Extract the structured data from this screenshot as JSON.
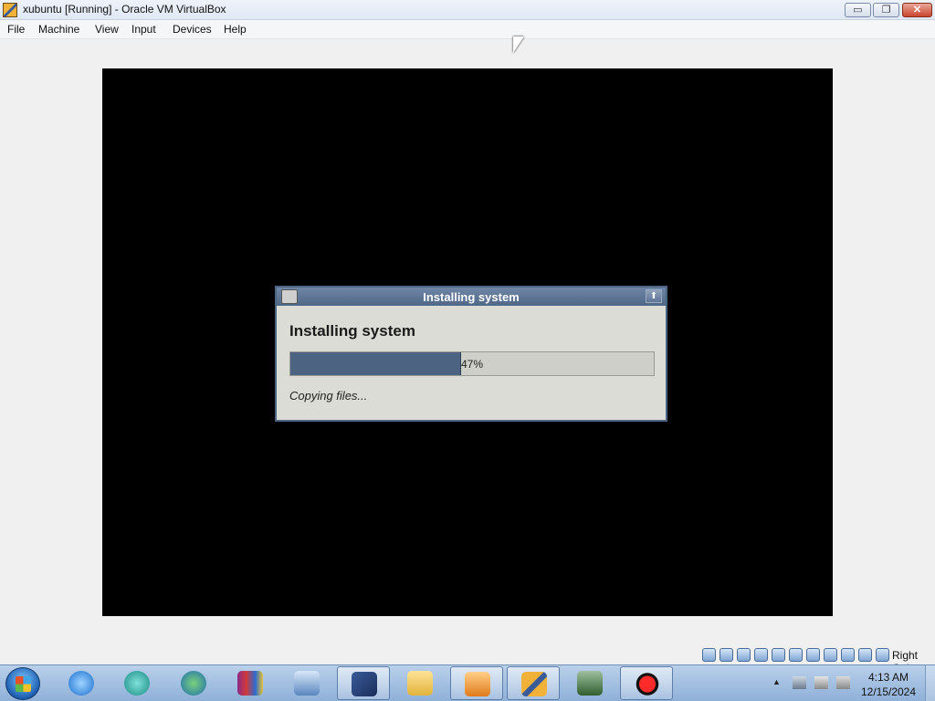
{
  "window": {
    "title": "xubuntu [Running] - Oracle VM VirtualBox",
    "minimize_symbol": "▭",
    "maximize_symbol": "❐",
    "close_symbol": "✕"
  },
  "menu": {
    "items": [
      "File",
      "Machine",
      "View",
      "Input",
      "Devices",
      "Help"
    ]
  },
  "installer": {
    "title": "Installing system",
    "heading": "Installing system",
    "progress_percent": 47,
    "progress_text": "47%",
    "status": "Copying files...",
    "title_button_symbol": "⬆"
  },
  "vbox_status": {
    "host_key_label": "Right Ctrl"
  },
  "taskbar": {
    "clock_time": "4:13 AM",
    "clock_date": "12/15/2024",
    "tray_arrow": "▲"
  },
  "colors": {
    "dialog_titlebar": "#506887",
    "progress_fill": "#4d6382",
    "vm_screen": "#000000"
  }
}
